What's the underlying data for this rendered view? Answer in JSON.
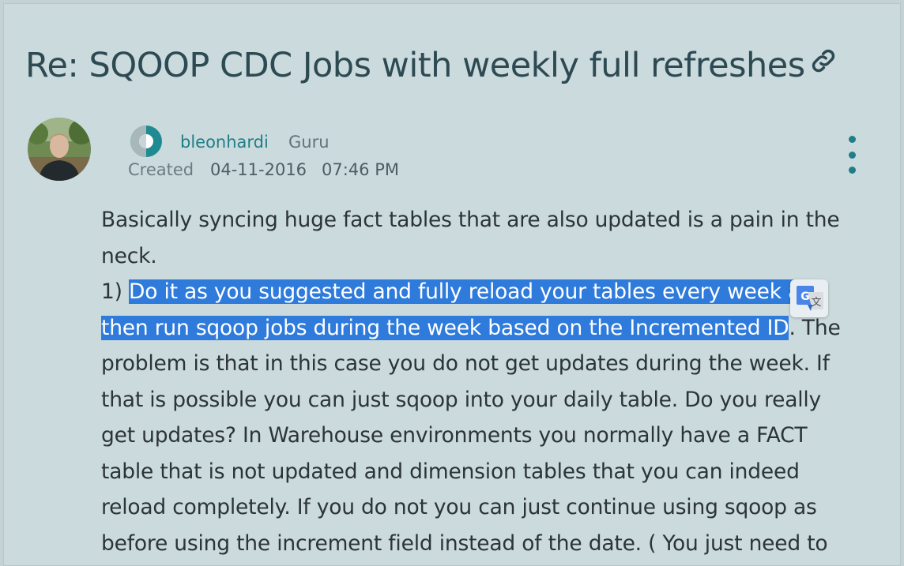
{
  "post": {
    "title": "Re: SQOOP CDC Jobs with weekly full refreshes",
    "author": "bleonhardi",
    "rank": "Guru",
    "created_label": "Created",
    "created_date": "04-11-2016",
    "created_time": "07:46 PM"
  },
  "body": {
    "line1": "Basically syncing huge fact tables that are also updated is a pain in the",
    "line2": "neck.",
    "line3_prefix": "1) ",
    "line3_highlight": "Do it as you suggested and fully reload your tables every week a",
    "line4_highlight": "then run sqoop jobs during the week based on the Incremented ID",
    "line4_suffix": ". The",
    "line5": "problem is that in this case you do not get updates during the week. If",
    "line6": "that is possible you can just sqoop into your daily table. Do you really",
    "line7": "get updates? In Warehouse environments you normally have a FACT",
    "line8": "table that is not updated and dimension tables that you can indeed",
    "line9": "reload completely. If you do not you can just continue using sqoop as",
    "line10": "before using the increment field instead of the date. ( You just need to"
  },
  "icons": {
    "title_link": "link-icon",
    "rank": "rank-badge-icon",
    "menu": "more-options-icon",
    "translate": "google-translate-icon"
  },
  "colors": {
    "accent": "#1f7f86",
    "title": "#2d4a52",
    "highlight": "#2f7bdc"
  }
}
